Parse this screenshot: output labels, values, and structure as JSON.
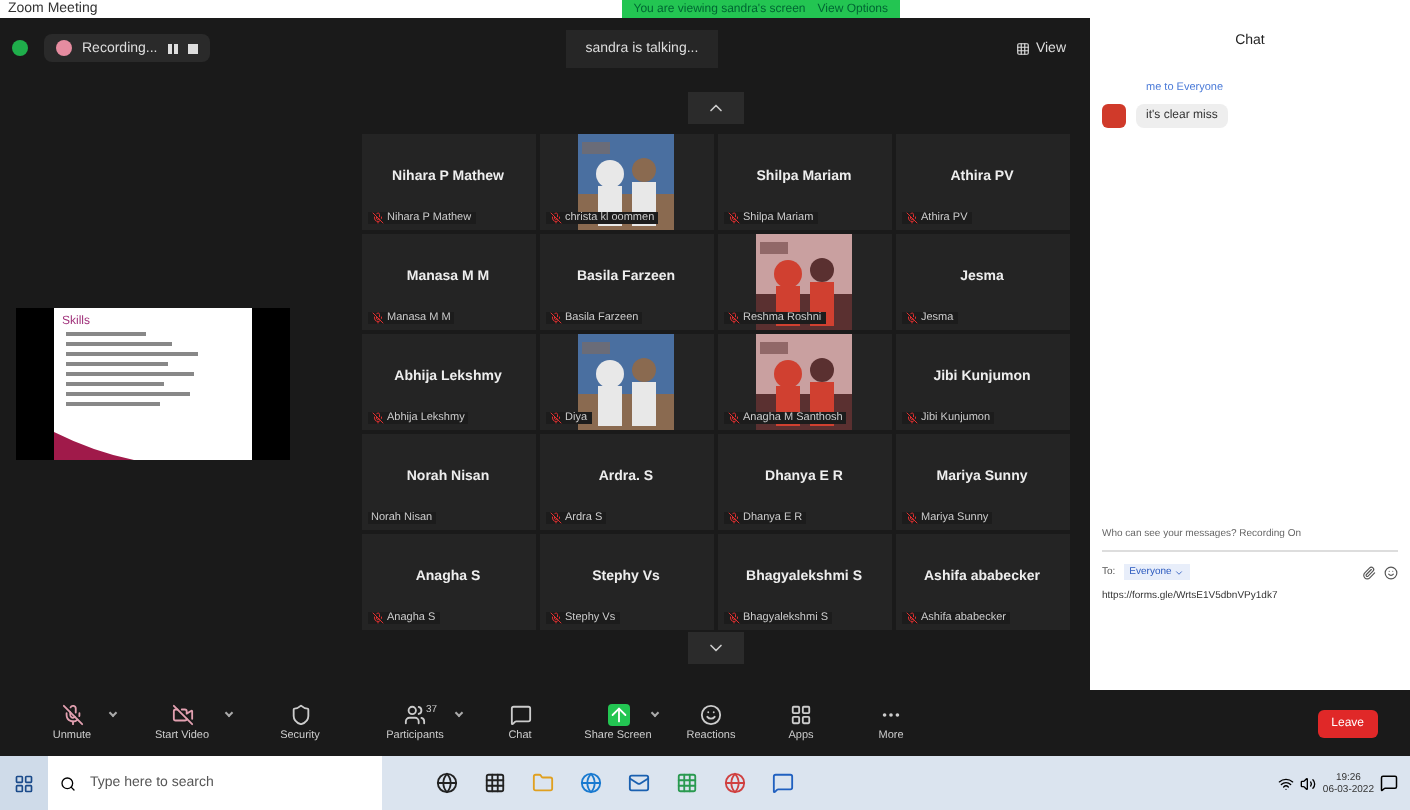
{
  "window": {
    "title": "Zoom Meeting"
  },
  "banner": {
    "text": "You are viewing sandra's screen",
    "button": "View Options"
  },
  "recording": {
    "label": "Recording..."
  },
  "speaker": "sandra is talking...",
  "view_button": "View",
  "slide": {
    "title": "Skills"
  },
  "tiles": [
    {
      "kind": "name",
      "name": "Nihara P Mathew",
      "caption": "Nihara P Mathew",
      "muted": true
    },
    {
      "kind": "picture",
      "caption": "christa kl oommen",
      "muted": true
    },
    {
      "kind": "name",
      "name": "Shilpa Mariam",
      "caption": "Shilpa Mariam",
      "muted": true
    },
    {
      "kind": "name",
      "name": "Athira PV",
      "caption": "Athira PV",
      "muted": true
    },
    {
      "kind": "name",
      "name": "Manasa M M",
      "caption": "Manasa M M",
      "muted": true
    },
    {
      "kind": "name",
      "name": "Basila Farzeen",
      "caption": "Basila Farzeen",
      "muted": true
    },
    {
      "kind": "picture",
      "caption": "Reshma Roshni",
      "muted": true
    },
    {
      "kind": "name",
      "name": "Jesma",
      "caption": "Jesma",
      "muted": true
    },
    {
      "kind": "name",
      "name": "Abhija Lekshmy",
      "caption": "Abhija Lekshmy",
      "muted": true
    },
    {
      "kind": "picture",
      "caption": "Diya",
      "muted": true
    },
    {
      "kind": "picture",
      "caption": "Anagha M Santhosh",
      "muted": true
    },
    {
      "kind": "name",
      "name": "Jibi Kunjumon",
      "caption": "Jibi Kunjumon",
      "muted": true
    },
    {
      "kind": "name",
      "name": "Norah Nisan",
      "caption": "Norah Nisan",
      "muted": false
    },
    {
      "kind": "name",
      "name": "Ardra. S",
      "caption": "Ardra S",
      "muted": true
    },
    {
      "kind": "name",
      "name": "Dhanya E R",
      "caption": "Dhanya E R",
      "muted": true
    },
    {
      "kind": "name",
      "name": "Mariya Sunny",
      "caption": "Mariya Sunny",
      "muted": true
    },
    {
      "kind": "name",
      "name": "Anagha S",
      "caption": "Anagha S",
      "muted": true
    },
    {
      "kind": "name",
      "name": "Stephy Vs",
      "caption": "Stephy Vs",
      "muted": true
    },
    {
      "kind": "name",
      "name": "Bhagyalekshmi S",
      "caption": "Bhagyalekshmi S",
      "muted": true
    },
    {
      "kind": "name",
      "name": "Ashifa ababecker",
      "caption": "Ashifa ababecker",
      "muted": true
    }
  ],
  "toolbar": [
    {
      "kind": "mic",
      "label": "Unmute",
      "caret": true
    },
    {
      "kind": "video",
      "label": "Start Video",
      "caret": true
    },
    {
      "kind": "security",
      "label": "Security",
      "caret": false
    },
    {
      "kind": "participants",
      "label": "Participants",
      "count": "37",
      "caret": true
    },
    {
      "kind": "chat",
      "label": "Chat",
      "caret": false
    },
    {
      "kind": "share",
      "label": "Share Screen",
      "caret": true
    },
    {
      "kind": "reactions",
      "label": "Reactions",
      "caret": false
    },
    {
      "kind": "apps",
      "label": "Apps",
      "caret": false
    },
    {
      "kind": "more",
      "label": "More",
      "caret": false
    }
  ],
  "leave_button": "Leave",
  "chat": {
    "title": "Chat",
    "messages": [
      {
        "header": "me to Everyone",
        "text": "it's clear miss"
      }
    ],
    "visibility_note": "Who can see your messages? Recording On",
    "to_label": "To:",
    "recipient": "Everyone",
    "draft": "https://forms.gle/WrtsE1V5dbnVPy1dk7"
  },
  "taskbar": {
    "search_placeholder": "Type here to search",
    "time": "19:26",
    "date": "06-03-2022"
  }
}
